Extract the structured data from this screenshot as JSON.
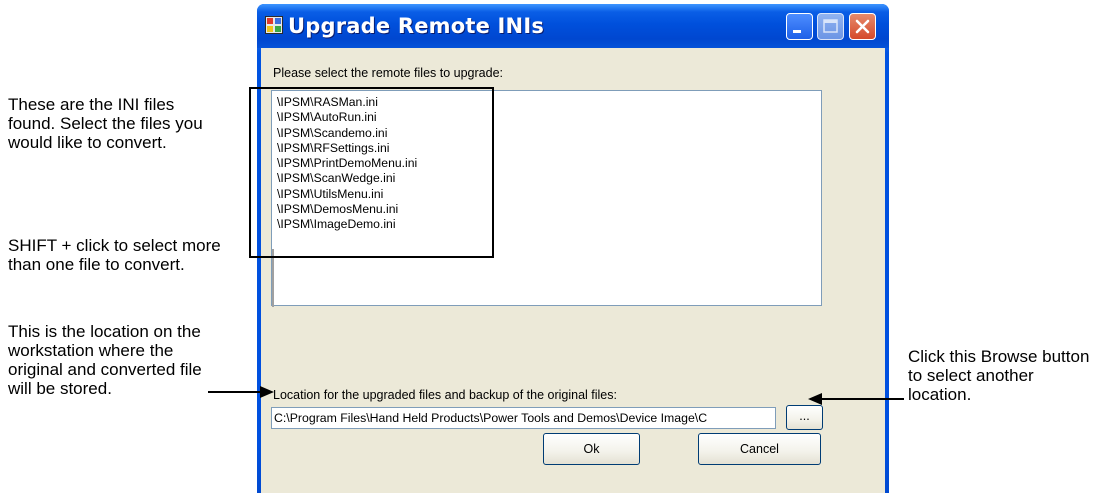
{
  "annotations": {
    "ini_files": "These are the INI files found. Select the files you would like to convert.",
    "shift_click": "SHIFT + click to select more than one file to convert.",
    "location": "This is the location on the workstation where the original and converted file will be stored.",
    "browse": "Click this Browse button to select another location."
  },
  "window": {
    "title": "Upgrade Remote INIs",
    "icon": "app-window-icon",
    "controls": [
      "minimize-icon",
      "maximize-icon",
      "close-icon"
    ]
  },
  "dialog": {
    "select_label": "Please select the remote files to upgrade:",
    "files": [
      "\\IPSM\\RASMan.ini",
      "\\IPSM\\AutoRun.ini",
      "\\IPSM\\Scandemo.ini",
      "\\IPSM\\RFSettings.ini",
      "\\IPSM\\PrintDemoMenu.ini",
      "\\IPSM\\ScanWedge.ini",
      "\\IPSM\\UtilsMenu.ini",
      "\\IPSM\\DemosMenu.ini",
      "\\IPSM\\ImageDemo.ini"
    ],
    "location_label": "Location for the upgraded files and backup of the original files:",
    "location_value": "C:\\Program Files\\Hand Held Products\\Power Tools and Demos\\Device Image\\C",
    "browse_label": "...",
    "ok_label": "Ok",
    "cancel_label": "Cancel"
  },
  "colors": {
    "titlebar": "#0050dc",
    "client_bg": "#ece9d8",
    "border": "#7f9db9",
    "close_button": "#d5492a"
  }
}
